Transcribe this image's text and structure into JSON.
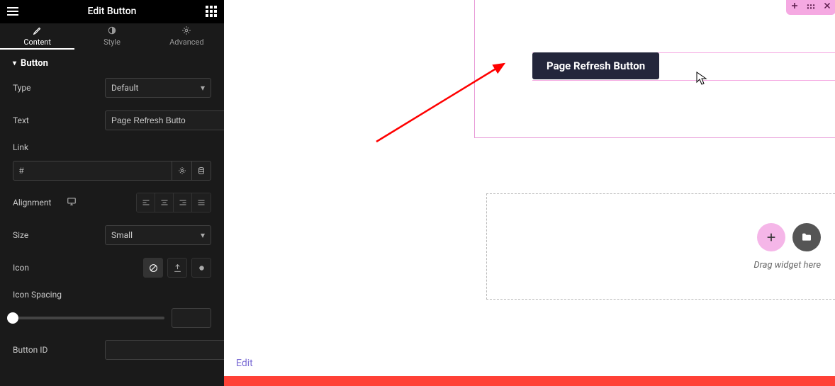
{
  "header": {
    "title": "Edit Button"
  },
  "tabs": {
    "content": "Content",
    "style": "Style",
    "advanced": "Advanced"
  },
  "section": {
    "title": "Button"
  },
  "fields": {
    "type": {
      "label": "Type",
      "value": "Default"
    },
    "text": {
      "label": "Text",
      "value": "Page Refresh Butto"
    },
    "link": {
      "label": "Link",
      "value": "#"
    },
    "alignment": {
      "label": "Alignment"
    },
    "size": {
      "label": "Size",
      "value": "Small"
    },
    "icon": {
      "label": "Icon"
    },
    "icon_spacing": {
      "label": "Icon Spacing",
      "value": ""
    },
    "button_id": {
      "label": "Button ID",
      "value": ""
    }
  },
  "canvas": {
    "preview_button": "Page Refresh Button",
    "edit_link": "Edit",
    "drop_text": "Drag widget here"
  },
  "colors": {
    "accent": "#f5a9e2",
    "bottom_bar": "#ff4136"
  }
}
